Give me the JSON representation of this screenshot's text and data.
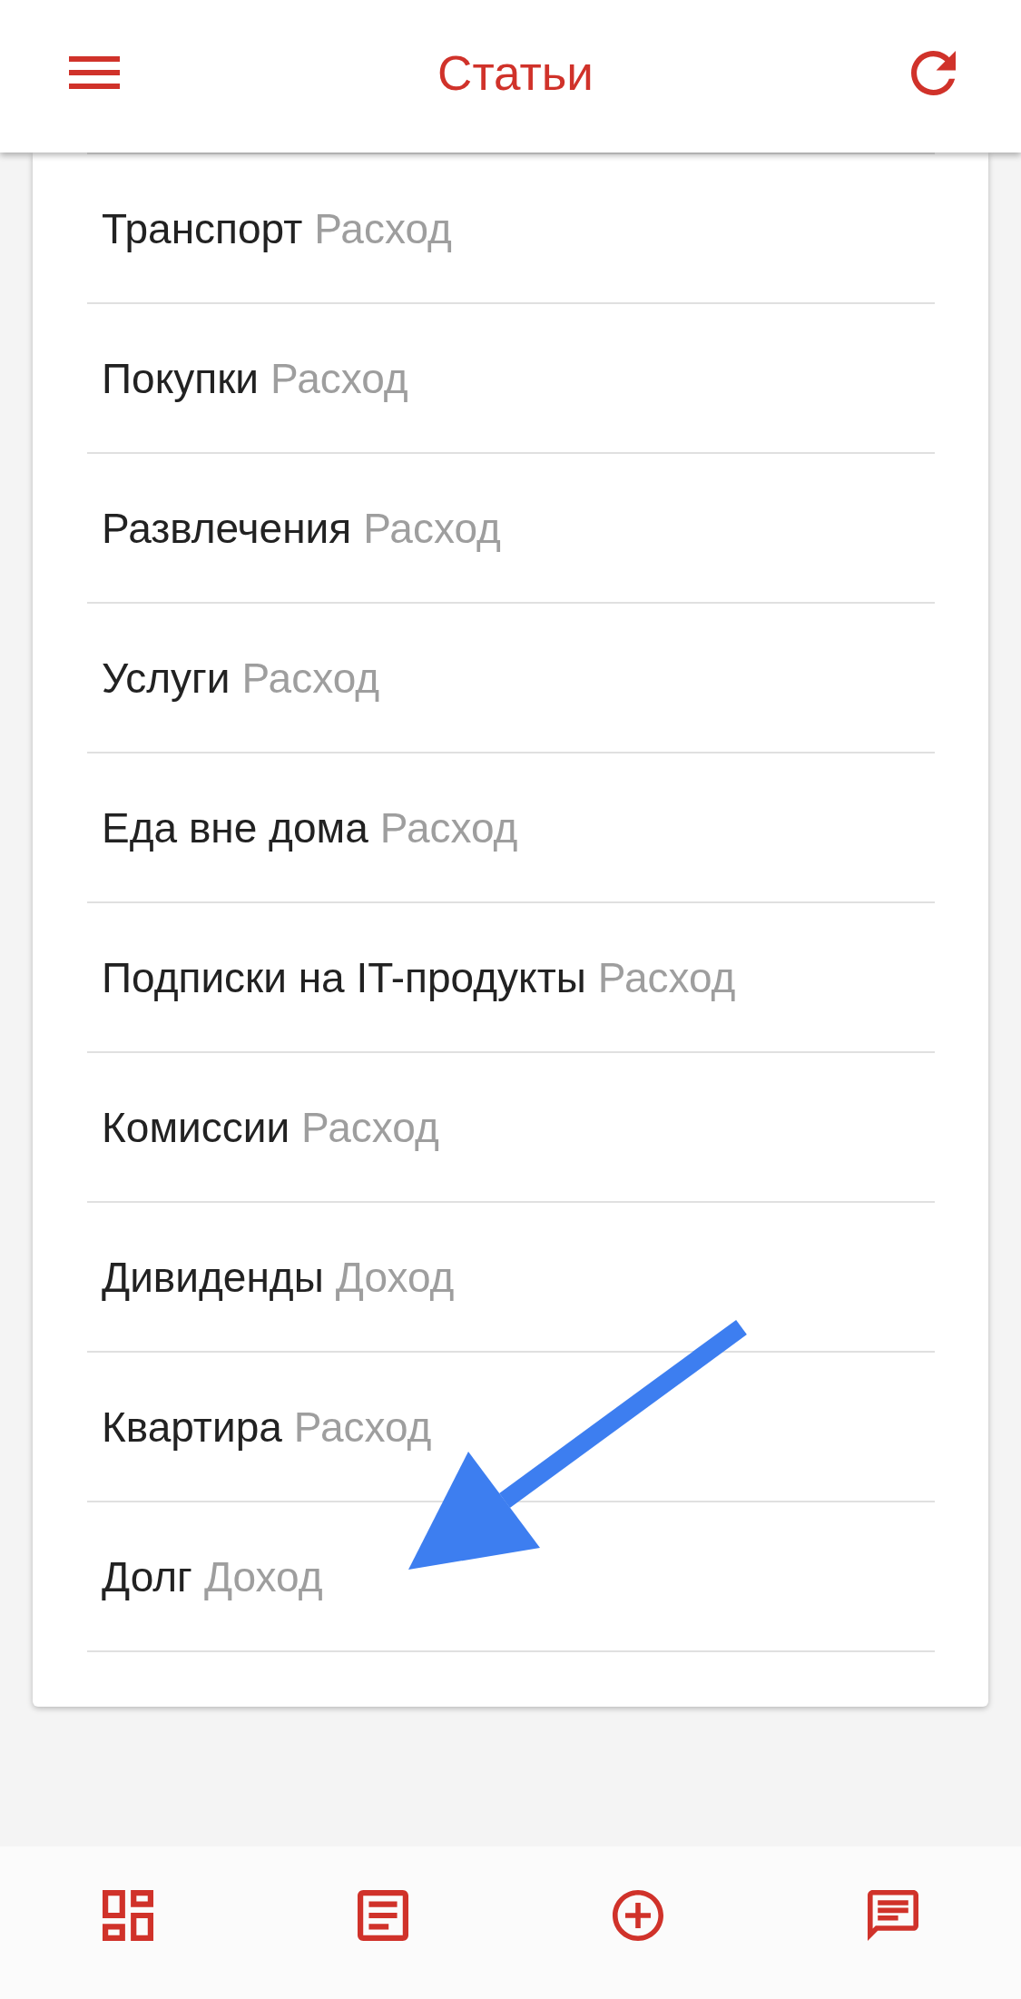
{
  "header": {
    "title": "Статьи"
  },
  "articles": [
    {
      "name": "Транспорт",
      "type": "Расход"
    },
    {
      "name": "Покупки",
      "type": "Расход"
    },
    {
      "name": "Развлечения",
      "type": "Расход"
    },
    {
      "name": "Услуги",
      "type": "Расход"
    },
    {
      "name": "Еда вне дома",
      "type": "Расход"
    },
    {
      "name": "Подписки на IT-продукты",
      "type": "Расход"
    },
    {
      "name": "Комиссии",
      "type": "Расход"
    },
    {
      "name": "Дивиденды",
      "type": "Доход"
    },
    {
      "name": "Квартира",
      "type": "Расход"
    },
    {
      "name": "Долг",
      "type": "Доход"
    }
  ]
}
